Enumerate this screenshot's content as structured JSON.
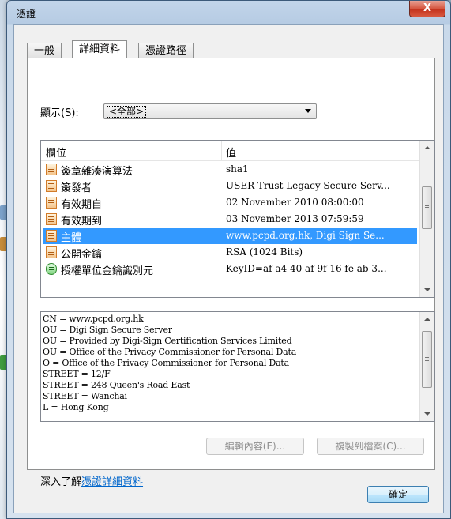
{
  "window": {
    "title": "憑證",
    "close_glyph": "X"
  },
  "tabs": [
    {
      "label": "一般",
      "active": false
    },
    {
      "label": "詳細資料",
      "active": true
    },
    {
      "label": "憑證路徑",
      "active": false
    }
  ],
  "show": {
    "label": "顯示(S):",
    "selected": "<全部>"
  },
  "list": {
    "headers": {
      "field": "欄位",
      "value": "值"
    },
    "rows": [
      {
        "field": "簽章雜湊演算法",
        "value": "sha1",
        "icon": "certificate-field-icon"
      },
      {
        "field": "簽發者",
        "value": "USER Trust Legacy Secure Serv...",
        "icon": "certificate-field-icon"
      },
      {
        "field": "有效期自",
        "value": "02 November 2010 08:00:00",
        "icon": "certificate-field-icon"
      },
      {
        "field": "有效期到",
        "value": "03 November 2013 07:59:59",
        "icon": "certificate-field-icon"
      },
      {
        "field": "主體",
        "value": "www.pcpd.org.hk, Digi Sign Se...",
        "icon": "certificate-field-icon",
        "selected": true
      },
      {
        "field": "公開金鑰",
        "value": "RSA (1024 Bits)",
        "icon": "certificate-field-icon"
      },
      {
        "field": "授權單位金鑰識別元",
        "value": "KeyID=af a4 40 af 9f 16 fe ab 3...",
        "icon": "extension-icon"
      }
    ]
  },
  "details": [
    "CN = www.pcpd.org.hk",
    "OU = Digi Sign Secure Server",
    "OU = Provided by Digi-Sign Certification Services Limited",
    "OU = Office of the Privacy Commissioner for Personal Data",
    "O = Office of the Privacy Commissioner for Personal Data",
    "STREET = 12/F",
    "STREET = 248 Queen's Road East",
    "STREET = Wanchai",
    "L = Hong Kong"
  ],
  "buttons": {
    "edit_properties": "編輯內容(E)...",
    "copy_to_file": "複製到檔案(C)...",
    "ok": "確定"
  },
  "learn_more": {
    "prefix": "深入了解",
    "link": "憑證詳細資料"
  },
  "colors": {
    "selection": "#3399ff",
    "link": "#0066cc",
    "close": "#c2301b"
  }
}
